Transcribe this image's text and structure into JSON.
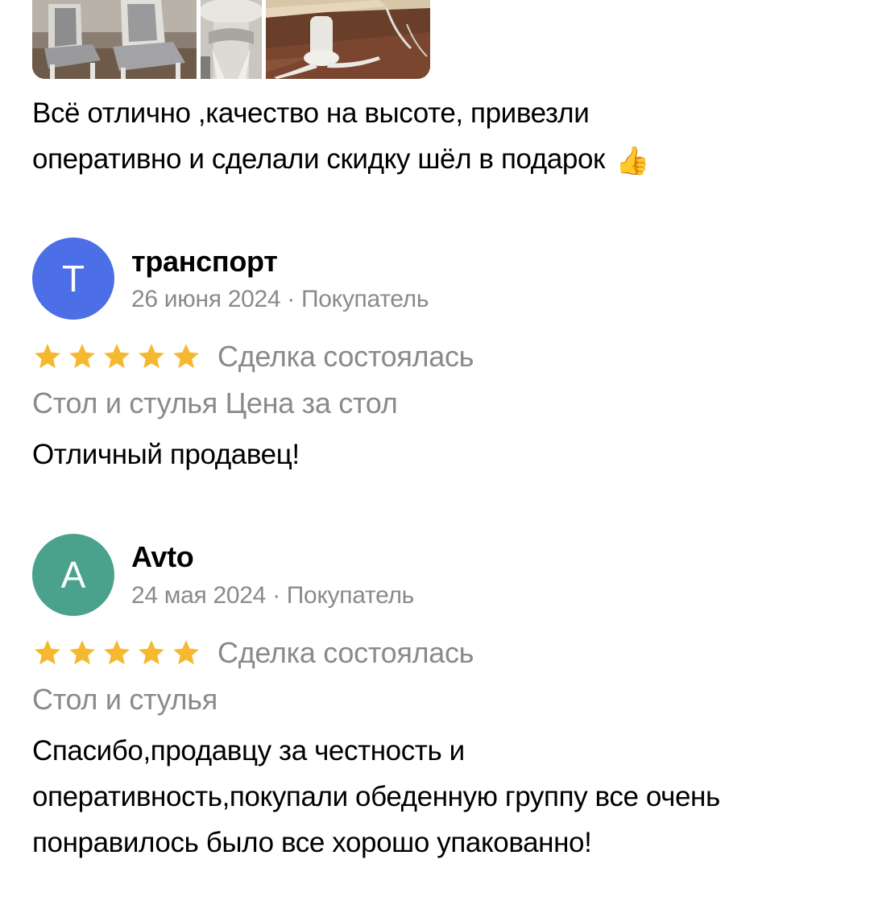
{
  "top_review": {
    "photos": [
      "chairs-photo",
      "table-top-photo",
      "table-leg-photo"
    ],
    "text_line1": "Всё отлично ,качество на высоте, привезли",
    "text_line2": "оперативно и сделали скидку шёл в подарок",
    "emoji": "👍"
  },
  "reviews": [
    {
      "avatar_letter": "Т",
      "avatar_color": "#4c6ee6",
      "author": "транспорт",
      "meta": "26 июня 2024 · Покупатель",
      "rating": 5,
      "status": "Сделка состоялась",
      "item": "Стол и стулья Цена за стол",
      "text_lines": [
        "Отличный продавец!"
      ]
    },
    {
      "avatar_letter": "А",
      "avatar_color": "#4ba28c",
      "author": "Avto",
      "meta": "24 мая 2024 · Покупатель",
      "rating": 5,
      "status": "Сделка состоялась",
      "item": "Стол и стулья",
      "text_lines": [
        "Спасибо,продавцу за честность и",
        "оперативность,покупали обеденную группу все очень",
        "понравилось было все хорошо упакованно!"
      ]
    }
  ],
  "colors": {
    "star": "#f5b82e",
    "muted_text": "#8a8a8a"
  }
}
